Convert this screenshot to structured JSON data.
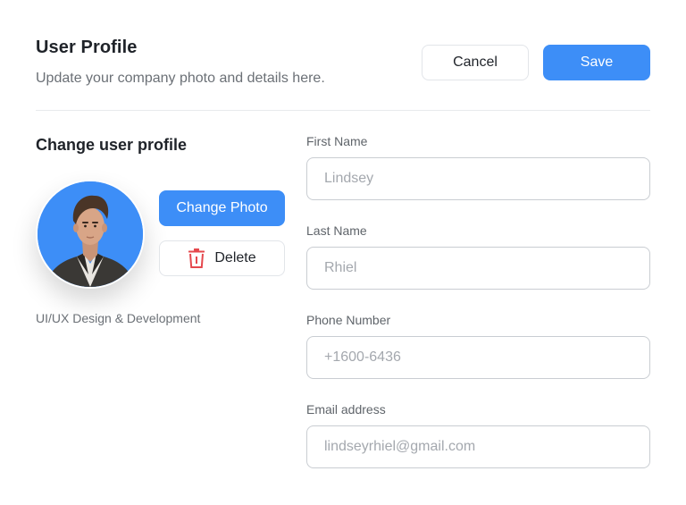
{
  "header": {
    "title": "User Profile",
    "subtitle": "Update your company photo and details here.",
    "cancel_label": "Cancel",
    "save_label": "Save"
  },
  "profile": {
    "section_title": "Change user profile",
    "change_photo_label": "Change Photo",
    "delete_label": "Delete",
    "role": "UI/UX Design & Development",
    "avatar_bg": "#3d8ef7"
  },
  "form": {
    "first_name": {
      "label": "First Name",
      "placeholder": "Lindsey"
    },
    "last_name": {
      "label": "Last Name",
      "placeholder": "Rhiel"
    },
    "phone": {
      "label": "Phone Number",
      "placeholder": "+1600-6436"
    },
    "email": {
      "label": "Email address",
      "placeholder": "lindseyrhiel@gmail.com"
    }
  },
  "colors": {
    "accent": "#3d8ef7",
    "delete_icon": "#e5484d"
  },
  "icons": {
    "delete": "trash-icon"
  }
}
